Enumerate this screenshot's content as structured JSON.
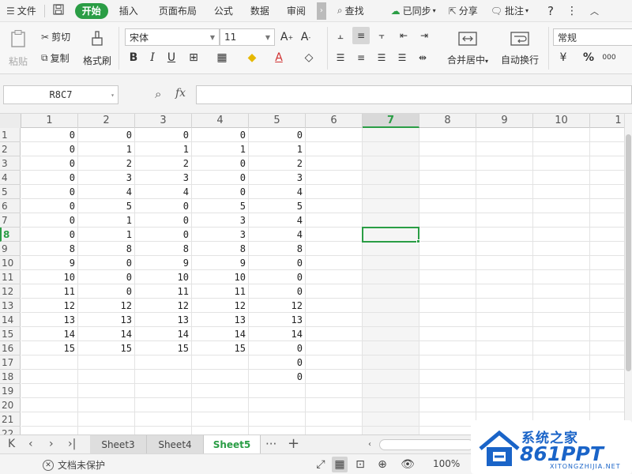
{
  "menubar": {
    "file_label": "文件",
    "tabs": [
      "开始",
      "插入",
      "页面布局",
      "公式",
      "数据",
      "审阅"
    ],
    "active_tab": "开始",
    "find_label": "查找",
    "sync_label": "已同步",
    "share_label": "分享",
    "comment_label": "批注",
    "help_label": "?"
  },
  "ribbon": {
    "paste_label": "粘贴",
    "cut_label": "剪切",
    "copy_label": "复制",
    "format_painter_label": "格式刷",
    "font_name": "宋体",
    "font_size": "11",
    "bold": "B",
    "italic": "I",
    "underline": "U",
    "merge_center_label": "合并居中",
    "wrap_text_label": "自动换行",
    "number_format": "常规",
    "percent": "%",
    "thousands": "000"
  },
  "formula_bar": {
    "name_box": "R8C7",
    "fx": "fx",
    "formula_value": ""
  },
  "grid": {
    "col_headers": [
      "1",
      "2",
      "3",
      "4",
      "5",
      "6",
      "7",
      "8",
      "9",
      "10",
      "1"
    ],
    "selected_col": "7",
    "row_headers": [
      "1",
      "2",
      "3",
      "4",
      "5",
      "6",
      "7",
      "8",
      "9",
      "10",
      "11",
      "12",
      "13",
      "14",
      "15",
      "16",
      "17",
      "18",
      "19",
      "20",
      "21",
      "22"
    ],
    "selected_row": "8",
    "rows": [
      [
        "0",
        "0",
        "0",
        "0",
        "0"
      ],
      [
        "0",
        "1",
        "1",
        "1",
        "1"
      ],
      [
        "0",
        "2",
        "2",
        "0",
        "2"
      ],
      [
        "0",
        "3",
        "3",
        "0",
        "3"
      ],
      [
        "0",
        "4",
        "4",
        "0",
        "4"
      ],
      [
        "0",
        "5",
        "0",
        "5",
        "5"
      ],
      [
        "0",
        "1",
        "0",
        "3",
        "4"
      ],
      [
        "0",
        "1",
        "0",
        "3",
        "4"
      ],
      [
        "8",
        "8",
        "8",
        "8",
        "8"
      ],
      [
        "9",
        "0",
        "9",
        "9",
        "0"
      ],
      [
        "10",
        "0",
        "10",
        "10",
        "0"
      ],
      [
        "11",
        "0",
        "11",
        "11",
        "0"
      ],
      [
        "12",
        "12",
        "12",
        "12",
        "12"
      ],
      [
        "13",
        "13",
        "13",
        "13",
        "13"
      ],
      [
        "14",
        "14",
        "14",
        "14",
        "14"
      ],
      [
        "15",
        "15",
        "15",
        "15",
        "0"
      ],
      [
        "",
        "",
        "",
        "",
        "0"
      ],
      [
        "",
        "",
        "",
        "",
        "0"
      ],
      [
        "",
        "",
        "",
        "",
        ""
      ],
      [
        "",
        "",
        "",
        "",
        ""
      ],
      [
        "",
        "",
        "",
        "",
        ""
      ],
      [
        "",
        "",
        "",
        "",
        ""
      ]
    ]
  },
  "sheets": {
    "tabs": [
      "Sheet3",
      "Sheet4",
      "Sheet5"
    ],
    "active": "Sheet5",
    "more": "···",
    "add": "+"
  },
  "statusbar": {
    "protect_label": "文档未保护",
    "zoom": "100%"
  },
  "watermark": {
    "title": "系统之家",
    "brand": "861PPT",
    "url": "XITONGZHIJIA.NET"
  },
  "colors": {
    "accent": "#2a9d45",
    "watermark_blue": "#1a64c8"
  }
}
